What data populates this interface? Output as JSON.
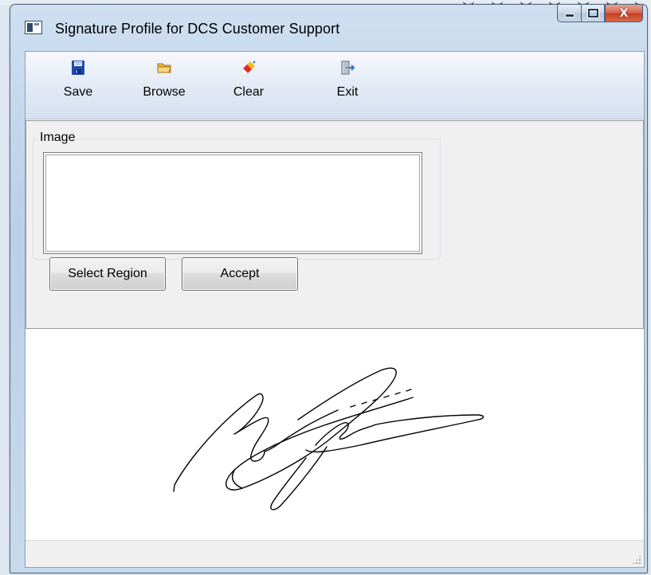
{
  "window": {
    "title": "Signature Profile for DCS Customer Support"
  },
  "caption_buttons": {
    "minimize_icon": "minimize-icon",
    "maximize_icon": "maximize-icon",
    "close_label": "X"
  },
  "toolbar": {
    "items": [
      {
        "label": "Save",
        "icon": "floppy-disk-icon"
      },
      {
        "label": "Browse",
        "icon": "folder-icon"
      },
      {
        "label": "Clear",
        "icon": "eraser-icon"
      },
      {
        "label": "Exit",
        "icon": "exit-door-icon"
      }
    ]
  },
  "image_group": {
    "legend": "Image"
  },
  "buttons": {
    "select_region": "Select Region",
    "accept": "Accept"
  },
  "signature": {
    "ink_color": "#000000"
  }
}
